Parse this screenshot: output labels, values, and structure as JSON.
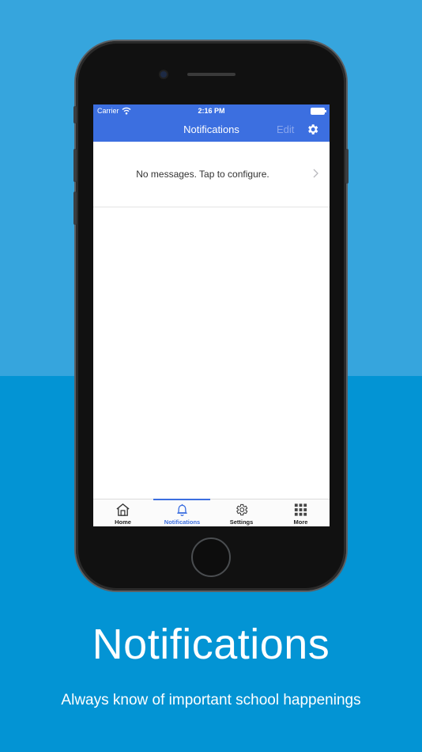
{
  "status": {
    "carrier": "Carrier",
    "time": "2:16 PM"
  },
  "navbar": {
    "title": "Notifications",
    "edit_label": "Edit",
    "settings_icon": "gear-icon"
  },
  "message": {
    "text": "No messages. Tap to configure."
  },
  "tabs": [
    {
      "label": "Home",
      "icon": "home-icon",
      "active": false
    },
    {
      "label": "Notifications",
      "icon": "bell-icon",
      "active": true
    },
    {
      "label": "Settings",
      "icon": "gear-icon",
      "active": false
    },
    {
      "label": "More",
      "icon": "grid-icon",
      "active": false
    }
  ],
  "caption": {
    "title": "Notifications",
    "subtitle": "Always know of important school happenings"
  },
  "colors": {
    "accent": "#3c6fe0",
    "bg_top": "#36a5dd",
    "bg_bottom": "#0394d4"
  }
}
